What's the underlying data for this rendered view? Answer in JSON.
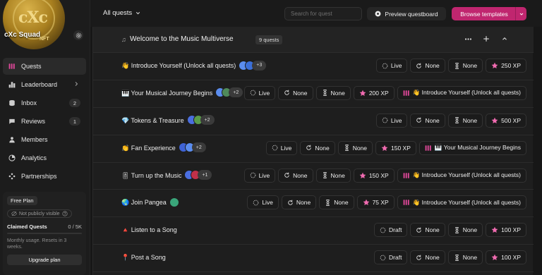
{
  "community": {
    "name": "cXc Squad",
    "coin_text": "cXc",
    "coin_nft": "NFT"
  },
  "sidebar": {
    "items": [
      {
        "label": "Quests",
        "icon": "quests-icon",
        "active": true
      },
      {
        "label": "Leaderboard",
        "icon": "leaderboard-icon",
        "chevron": true
      },
      {
        "label": "Inbox",
        "icon": "inbox-icon",
        "badge": "2"
      },
      {
        "label": "Reviews",
        "icon": "reviews-icon",
        "badge": "1"
      },
      {
        "label": "Members",
        "icon": "members-icon"
      },
      {
        "label": "Analytics",
        "icon": "analytics-icon"
      },
      {
        "label": "Partnerships",
        "icon": "partnerships-icon"
      }
    ]
  },
  "plan": {
    "tag": "Free Plan",
    "visibility": "Not publicly visible",
    "claimed_label": "Claimed Quests",
    "claimed_value": "0 / 5K",
    "note": "Monthly usage. Resets in 3 weeks.",
    "upgrade": "Upgrade plan"
  },
  "topbar": {
    "filter": "All quests",
    "search_placeholder": "Search for quest",
    "preview": "Preview questboard",
    "browse": "Browse templates"
  },
  "section": {
    "title": "Welcome to the Music Multiverse",
    "count": "9 quests"
  },
  "colors": {
    "accent": "#c0266f",
    "xp_star": "#f06bb0",
    "unlock_icon": "#e0489a"
  },
  "quests": [
    {
      "title": "👋 Introduce Yourself (Unlock all quests)",
      "avatars": [
        "#5b8def",
        "#3b6fd8"
      ],
      "more": "+3",
      "status": "Live",
      "recurrence": "None",
      "cooldown": "None",
      "xp": "250 XP",
      "unlock": ""
    },
    {
      "title": "🎹 Your Musical Journey Begins",
      "avatars": [
        "#5b8def",
        "#4f8a5a"
      ],
      "more": "+2",
      "status": "Live",
      "recurrence": "None",
      "cooldown": "None",
      "xp": "200 XP",
      "unlock": "👋 Introduce Yourself (Unlock all quests)"
    },
    {
      "title": "💎 Tokens & Treasure",
      "avatars": [
        "#4a6ee0",
        "#5a9a4a"
      ],
      "more": "+2",
      "status": "Live",
      "recurrence": "None",
      "cooldown": "None",
      "xp": "500 XP",
      "unlock": ""
    },
    {
      "title": "👏 Fan Experience",
      "avatars": [
        "#3f63d6",
        "#5b8def"
      ],
      "more": "+2",
      "status": "Live",
      "recurrence": "None",
      "cooldown": "None",
      "xp": "150 XP",
      "unlock": "🎹 Your Musical Journey Begins"
    },
    {
      "title": "🎚 Turn up the Music",
      "avatars": [
        "#4a6ee0",
        "#c0304a"
      ],
      "more": "+1",
      "status": "Live",
      "recurrence": "None",
      "cooldown": "None",
      "xp": "150 XP",
      "unlock": "👋 Introduce Yourself (Unlock all quests)"
    },
    {
      "title": "🌏 Join Pangea",
      "avatars": [
        "#3aa57a"
      ],
      "more": "",
      "status": "Live",
      "recurrence": "None",
      "cooldown": "None",
      "xp": "75 XP",
      "unlock": "👋 Introduce Yourself (Unlock all quests)"
    },
    {
      "title": "🔺 Listen to a Song",
      "avatars": [],
      "more": "",
      "status": "Draft",
      "recurrence": "None",
      "cooldown": "None",
      "xp": "100 XP",
      "unlock": ""
    },
    {
      "title": "📍 Post a Song",
      "avatars": [],
      "more": "",
      "status": "Draft",
      "recurrence": "None",
      "cooldown": "None",
      "xp": "100 XP",
      "unlock": ""
    }
  ]
}
